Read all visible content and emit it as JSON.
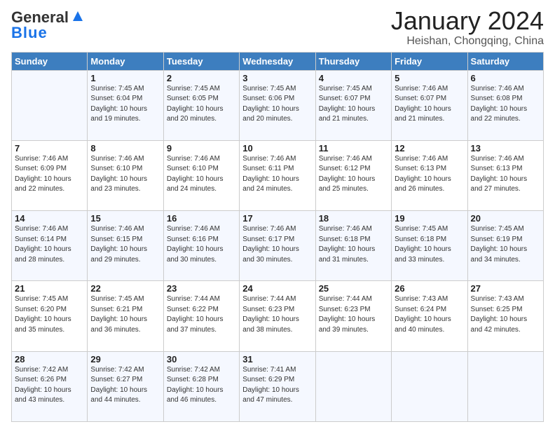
{
  "logo": {
    "text_general": "General",
    "text_blue": "Blue"
  },
  "header": {
    "month_title": "January 2024",
    "subtitle": "Heishan, Chongqing, China"
  },
  "days_of_week": [
    "Sunday",
    "Monday",
    "Tuesday",
    "Wednesday",
    "Thursday",
    "Friday",
    "Saturday"
  ],
  "weeks": [
    [
      {
        "day": "",
        "sunrise": "",
        "sunset": "",
        "daylight": ""
      },
      {
        "day": "1",
        "sunrise": "Sunrise: 7:45 AM",
        "sunset": "Sunset: 6:04 PM",
        "daylight": "Daylight: 10 hours and 19 minutes."
      },
      {
        "day": "2",
        "sunrise": "Sunrise: 7:45 AM",
        "sunset": "Sunset: 6:05 PM",
        "daylight": "Daylight: 10 hours and 20 minutes."
      },
      {
        "day": "3",
        "sunrise": "Sunrise: 7:45 AM",
        "sunset": "Sunset: 6:06 PM",
        "daylight": "Daylight: 10 hours and 20 minutes."
      },
      {
        "day": "4",
        "sunrise": "Sunrise: 7:45 AM",
        "sunset": "Sunset: 6:07 PM",
        "daylight": "Daylight: 10 hours and 21 minutes."
      },
      {
        "day": "5",
        "sunrise": "Sunrise: 7:46 AM",
        "sunset": "Sunset: 6:07 PM",
        "daylight": "Daylight: 10 hours and 21 minutes."
      },
      {
        "day": "6",
        "sunrise": "Sunrise: 7:46 AM",
        "sunset": "Sunset: 6:08 PM",
        "daylight": "Daylight: 10 hours and 22 minutes."
      }
    ],
    [
      {
        "day": "7",
        "sunrise": "Sunrise: 7:46 AM",
        "sunset": "Sunset: 6:09 PM",
        "daylight": "Daylight: 10 hours and 22 minutes."
      },
      {
        "day": "8",
        "sunrise": "Sunrise: 7:46 AM",
        "sunset": "Sunset: 6:10 PM",
        "daylight": "Daylight: 10 hours and 23 minutes."
      },
      {
        "day": "9",
        "sunrise": "Sunrise: 7:46 AM",
        "sunset": "Sunset: 6:10 PM",
        "daylight": "Daylight: 10 hours and 24 minutes."
      },
      {
        "day": "10",
        "sunrise": "Sunrise: 7:46 AM",
        "sunset": "Sunset: 6:11 PM",
        "daylight": "Daylight: 10 hours and 24 minutes."
      },
      {
        "day": "11",
        "sunrise": "Sunrise: 7:46 AM",
        "sunset": "Sunset: 6:12 PM",
        "daylight": "Daylight: 10 hours and 25 minutes."
      },
      {
        "day": "12",
        "sunrise": "Sunrise: 7:46 AM",
        "sunset": "Sunset: 6:13 PM",
        "daylight": "Daylight: 10 hours and 26 minutes."
      },
      {
        "day": "13",
        "sunrise": "Sunrise: 7:46 AM",
        "sunset": "Sunset: 6:13 PM",
        "daylight": "Daylight: 10 hours and 27 minutes."
      }
    ],
    [
      {
        "day": "14",
        "sunrise": "Sunrise: 7:46 AM",
        "sunset": "Sunset: 6:14 PM",
        "daylight": "Daylight: 10 hours and 28 minutes."
      },
      {
        "day": "15",
        "sunrise": "Sunrise: 7:46 AM",
        "sunset": "Sunset: 6:15 PM",
        "daylight": "Daylight: 10 hours and 29 minutes."
      },
      {
        "day": "16",
        "sunrise": "Sunrise: 7:46 AM",
        "sunset": "Sunset: 6:16 PM",
        "daylight": "Daylight: 10 hours and 30 minutes."
      },
      {
        "day": "17",
        "sunrise": "Sunrise: 7:46 AM",
        "sunset": "Sunset: 6:17 PM",
        "daylight": "Daylight: 10 hours and 30 minutes."
      },
      {
        "day": "18",
        "sunrise": "Sunrise: 7:46 AM",
        "sunset": "Sunset: 6:18 PM",
        "daylight": "Daylight: 10 hours and 31 minutes."
      },
      {
        "day": "19",
        "sunrise": "Sunrise: 7:45 AM",
        "sunset": "Sunset: 6:18 PM",
        "daylight": "Daylight: 10 hours and 33 minutes."
      },
      {
        "day": "20",
        "sunrise": "Sunrise: 7:45 AM",
        "sunset": "Sunset: 6:19 PM",
        "daylight": "Daylight: 10 hours and 34 minutes."
      }
    ],
    [
      {
        "day": "21",
        "sunrise": "Sunrise: 7:45 AM",
        "sunset": "Sunset: 6:20 PM",
        "daylight": "Daylight: 10 hours and 35 minutes."
      },
      {
        "day": "22",
        "sunrise": "Sunrise: 7:45 AM",
        "sunset": "Sunset: 6:21 PM",
        "daylight": "Daylight: 10 hours and 36 minutes."
      },
      {
        "day": "23",
        "sunrise": "Sunrise: 7:44 AM",
        "sunset": "Sunset: 6:22 PM",
        "daylight": "Daylight: 10 hours and 37 minutes."
      },
      {
        "day": "24",
        "sunrise": "Sunrise: 7:44 AM",
        "sunset": "Sunset: 6:23 PM",
        "daylight": "Daylight: 10 hours and 38 minutes."
      },
      {
        "day": "25",
        "sunrise": "Sunrise: 7:44 AM",
        "sunset": "Sunset: 6:23 PM",
        "daylight": "Daylight: 10 hours and 39 minutes."
      },
      {
        "day": "26",
        "sunrise": "Sunrise: 7:43 AM",
        "sunset": "Sunset: 6:24 PM",
        "daylight": "Daylight: 10 hours and 40 minutes."
      },
      {
        "day": "27",
        "sunrise": "Sunrise: 7:43 AM",
        "sunset": "Sunset: 6:25 PM",
        "daylight": "Daylight: 10 hours and 42 minutes."
      }
    ],
    [
      {
        "day": "28",
        "sunrise": "Sunrise: 7:42 AM",
        "sunset": "Sunset: 6:26 PM",
        "daylight": "Daylight: 10 hours and 43 minutes."
      },
      {
        "day": "29",
        "sunrise": "Sunrise: 7:42 AM",
        "sunset": "Sunset: 6:27 PM",
        "daylight": "Daylight: 10 hours and 44 minutes."
      },
      {
        "day": "30",
        "sunrise": "Sunrise: 7:42 AM",
        "sunset": "Sunset: 6:28 PM",
        "daylight": "Daylight: 10 hours and 46 minutes."
      },
      {
        "day": "31",
        "sunrise": "Sunrise: 7:41 AM",
        "sunset": "Sunset: 6:29 PM",
        "daylight": "Daylight: 10 hours and 47 minutes."
      },
      {
        "day": "",
        "sunrise": "",
        "sunset": "",
        "daylight": ""
      },
      {
        "day": "",
        "sunrise": "",
        "sunset": "",
        "daylight": ""
      },
      {
        "day": "",
        "sunrise": "",
        "sunset": "",
        "daylight": ""
      }
    ]
  ]
}
